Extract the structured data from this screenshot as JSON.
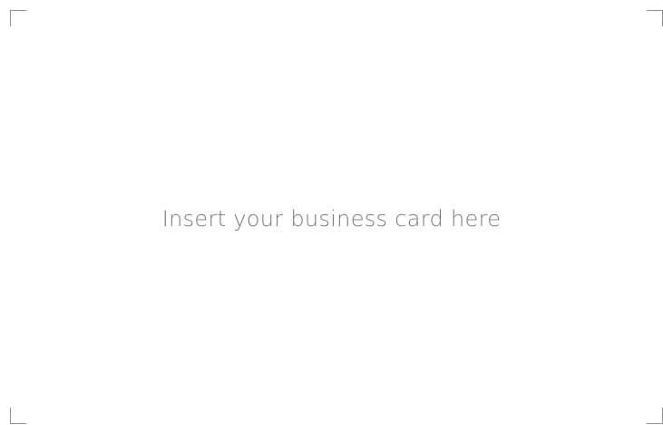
{
  "card_placeholder": {
    "text": "Insert your business card here"
  },
  "colors": {
    "background": "#ffffff",
    "text": "#7a7a7a",
    "crop_marks": "#8f8f8f"
  }
}
